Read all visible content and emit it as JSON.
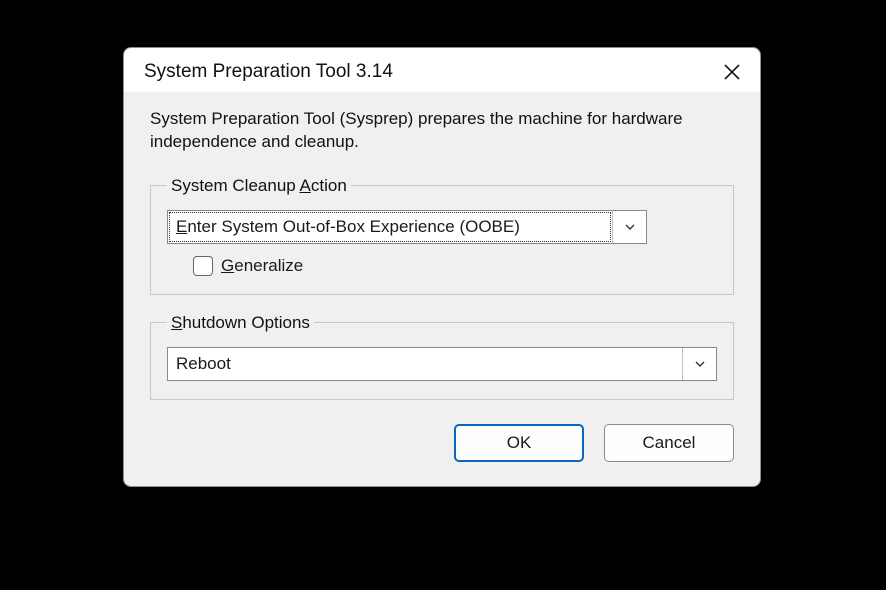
{
  "title": "System Preparation Tool 3.14",
  "description": "System Preparation Tool (Sysprep) prepares the machine for hardware independence and cleanup.",
  "cleanup": {
    "legend_prefix": "System Cleanup ",
    "legend_hotkey": "A",
    "legend_suffix": "ction",
    "combo_prefix": "E",
    "combo_suffix": "nter System Out-of-Box Experience (OOBE)",
    "generalize_hotkey": "G",
    "generalize_suffix": "eneralize",
    "generalize_checked": false
  },
  "shutdown": {
    "legend_hotkey": "S",
    "legend_suffix": "hutdown Options",
    "value": "Reboot"
  },
  "buttons": {
    "ok": "OK",
    "cancel": "Cancel"
  }
}
